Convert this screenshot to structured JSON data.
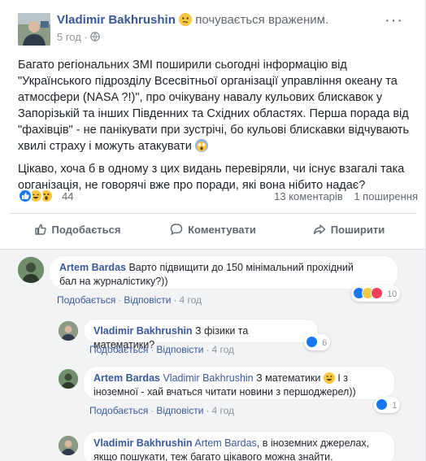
{
  "post": {
    "author": "Vladimir Bakhrushin",
    "feeling": "почувається враженим.",
    "time": "5 год",
    "paragraph1": "Багато регіональних ЗМІ поширили сьогодні інформацію від \"Українського підрозділу Всесвітньої організації управління океану та атмосфери (NASA ?!)\", про очікувану навалу кульових блискавок у Запорізькій та інших Південних та Східних областях. Перша порада від \"фахівців\" - не панікувати при зустрічі, бо кульові блискавки відчувають хвилі страху і можуть атакувати",
    "paragraph2": "Цікаво, хоча б в одному з цих видань перевіряли, чи існує взагалі така організація, не говорячі вже про поради, які вона нібито надає?"
  },
  "stats": {
    "reaction_count": "44",
    "comments": "13 коментарів",
    "shares": "1 поширення"
  },
  "actions": {
    "like": "Подобається",
    "comment": "Коментувати",
    "share": "Поширити"
  },
  "comments": [
    {
      "author": "Artem Bardas",
      "text_line1": "Варто підвищити до 150 мінімальний прохідний",
      "text_line2": "бал на журналістику?))",
      "like": "Подобається",
      "reply": "Відповісти",
      "time": "4 год",
      "reactions": "10"
    },
    {
      "author": "Vladimir Bakhrushin",
      "text": "З фізики та математики?",
      "like": "Подобається",
      "reply": "Відповісти",
      "time": "4 год",
      "reactions": "6"
    },
    {
      "author": "Artem Bardas",
      "mention": "Vladimir Bakhrushin",
      "text_line1": "З математики",
      "text_line1b": "І з",
      "text_line2": "іноземної - хай вчаться читати новини з першоджерел))",
      "like": "Подобається",
      "reply": "Відповісти",
      "time": "4 год",
      "reactions": "1"
    },
    {
      "author": "Vladimir Bakhrushin",
      "mention": "Artem Bardas",
      "text_line1": ", в іноземних джерелах,",
      "text_line2": "якщо пошукати, теж багато цікавого можна знайти."
    }
  ],
  "colors": {
    "link": "#385898",
    "like_blue": "#1877f2",
    "love_red": "#f33e58",
    "haha_yellow": "#f7c844"
  }
}
